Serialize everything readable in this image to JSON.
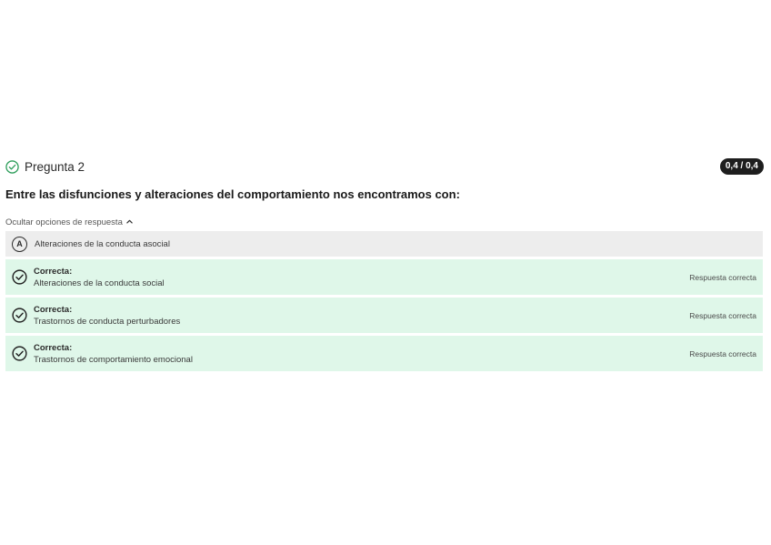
{
  "question": {
    "status_icon": "check-circle-icon",
    "title": "Pregunta 2",
    "score": "0,4 / 0,4",
    "text": "Entre las disfunciones y alteraciones del comportamiento nos encontramos con:",
    "toggle_label": "Ocultar opciones de respuesta",
    "toggle_icon": "chevron-up-icon",
    "colors": {
      "correct_bg": "#dff7e9",
      "neutral_bg": "#ededed",
      "badge_bg": "#1e1e1e",
      "success_icon": "#2e9e5b"
    },
    "options": [
      {
        "letter": "A",
        "text": "Alteraciones de la conducta asocial",
        "state": "neutral"
      },
      {
        "icon": "check-circle-icon",
        "label": "Correcta:",
        "text": "Alteraciones de la conducta social",
        "result": "Respuesta correcta",
        "state": "correct"
      },
      {
        "icon": "check-circle-icon",
        "label": "Correcta:",
        "text": "Trastornos de conducta perturbadores",
        "result": "Respuesta correcta",
        "state": "correct"
      },
      {
        "icon": "check-circle-icon",
        "label": "Correcta:",
        "text": "Trastornos de comportamiento emocional",
        "result": "Respuesta correcta",
        "state": "correct"
      }
    ]
  }
}
